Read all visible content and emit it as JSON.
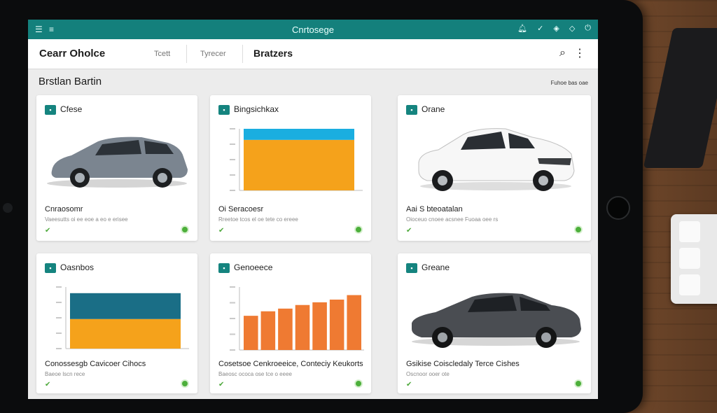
{
  "status_bar": {
    "title": "Cnrtosege",
    "menu_icon": "menu-icon",
    "icons": [
      "notification-icon",
      "check-icon",
      "shield-icon",
      "shield-icon",
      "power-icon"
    ]
  },
  "nav": {
    "brand": "Cearr Oholce",
    "tabs": [
      {
        "label": "Tcett"
      },
      {
        "label": "Tyrecer"
      },
      {
        "label": "Bratzers"
      }
    ],
    "search_icon": "search-icon",
    "more_icon": "more-vertical-icon"
  },
  "section": {
    "title": "Brstlan Bartin",
    "link": "Fuhoe bas oae"
  },
  "cards": [
    {
      "title": "Cfese",
      "label": "Cnraosomr",
      "desc": "Vaeesutts oi ee eoe a eo e erisee",
      "kind": "car-hatchback"
    },
    {
      "title": "Bingsichkax",
      "label": "Oi Seracoesr",
      "desc": "Rreetoe tcos el oe tete co ereee",
      "kind": "chart-stack"
    },
    {
      "title": "Orane",
      "label": "Aai S bteoatalan",
      "desc": "Oioceuo cnoee acsnee Fuoaa oee rs",
      "kind": "car-sedan-white"
    },
    {
      "title": "Oasnbos",
      "label": "Conossesgb Cavicoer Cihocs",
      "desc": "Baeoe lscn rece",
      "kind": "chart-block"
    },
    {
      "title": "Genoeece",
      "label": "Cosetsoe Cenkroeeice, Conteciy Keukorts",
      "desc": "Baeosc ococa ose tce o eeee",
      "kind": "chart-bars"
    },
    {
      "title": "Greane",
      "label": "Gsikise Coiscledaly Terce Cishes",
      "desc": "Oscnoor ooer ote",
      "kind": "car-sedan-dark"
    }
  ],
  "chart_data": [
    {
      "type": "bar",
      "categories": [
        "1"
      ],
      "series": [
        {
          "values": [
            82
          ]
        },
        {
          "values": [
            18
          ]
        }
      ],
      "colors": [
        "#f5a21b",
        "#1aaee0"
      ],
      "ylim": [
        0,
        100
      ],
      "stacked": true,
      "grid": false,
      "title": ""
    },
    {
      "type": "bar",
      "categories": [
        "1"
      ],
      "series": [
        {
          "values": [
            48
          ]
        },
        {
          "values": [
            42
          ]
        }
      ],
      "colors": [
        "#f5a21b",
        "#1a6e86"
      ],
      "ylim": [
        0,
        100
      ],
      "stacked": true,
      "grid": false,
      "title": ""
    },
    {
      "type": "bar",
      "categories": [
        "1",
        "2",
        "3",
        "4",
        "5",
        "6",
        "7"
      ],
      "values": [
        38,
        43,
        46,
        50,
        53,
        56,
        61
      ],
      "colors": [
        "#ef7a32"
      ],
      "ylim": [
        0,
        70
      ],
      "grid": false,
      "title": ""
    }
  ]
}
